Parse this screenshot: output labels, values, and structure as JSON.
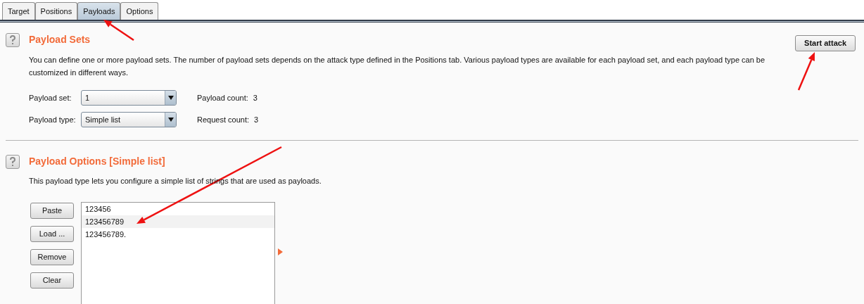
{
  "tabs": [
    {
      "label": "Target",
      "selected": false
    },
    {
      "label": "Positions",
      "selected": false
    },
    {
      "label": "Payloads",
      "selected": true
    },
    {
      "label": "Options",
      "selected": false
    }
  ],
  "payload_sets": {
    "title": "Payload Sets",
    "description": "You can define one or more payload sets. The number of payload sets depends on the attack type defined in the Positions tab. Various payload types are available for each payload set, and each payload type can be customized in different ways.",
    "start_button": "Start attack",
    "fields": [
      {
        "label": "Payload set:",
        "value": "1",
        "count_label": "Payload count:",
        "count": "3"
      },
      {
        "label": "Payload type:",
        "value": "Simple list",
        "count_label": "Request count:",
        "count": "3"
      }
    ]
  },
  "payload_options": {
    "title": "Payload Options [Simple list]",
    "description": "This payload type lets you configure a simple list of strings that are used as payloads.",
    "buttons": [
      "Paste",
      "Load ...",
      "Remove",
      "Clear"
    ],
    "items": [
      "123456",
      "123456789",
      "123456789."
    ]
  }
}
